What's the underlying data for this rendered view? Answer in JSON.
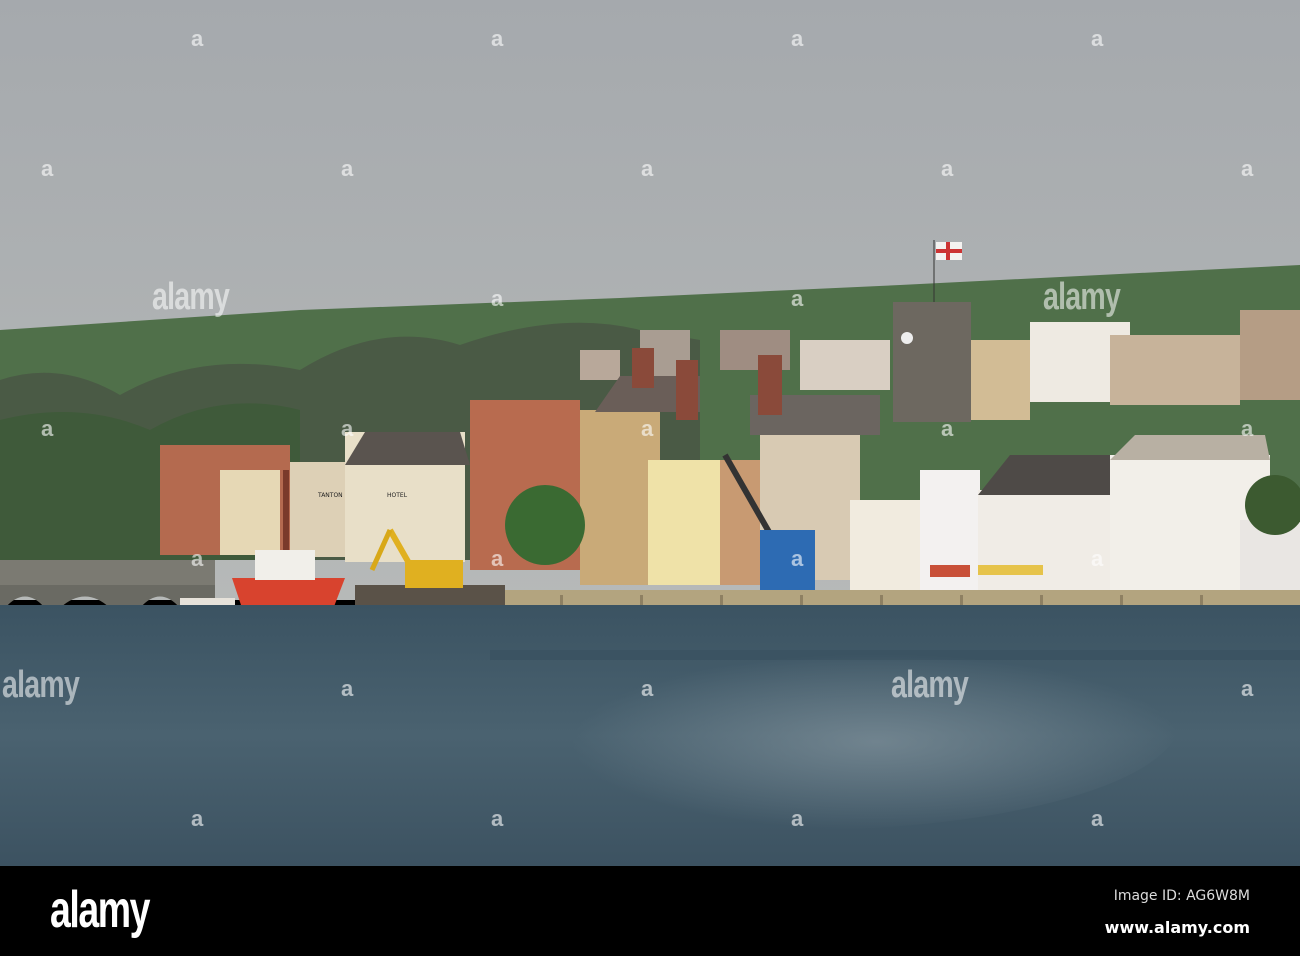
{
  "photo": {
    "description_sign_1": "TANTON",
    "description_sign_2": "HOTEL"
  },
  "watermark": {
    "text": "alamy",
    "mark": "a"
  },
  "footer": {
    "logo": "alamy",
    "image_id": "Image ID: AG6W8M",
    "website": "www.alamy.com"
  },
  "colors": {
    "sky": "#a9adb0",
    "hill": "#4e6a44",
    "water": "#3d5462",
    "boat": "#d8432e",
    "quay": "#b3a47f"
  }
}
